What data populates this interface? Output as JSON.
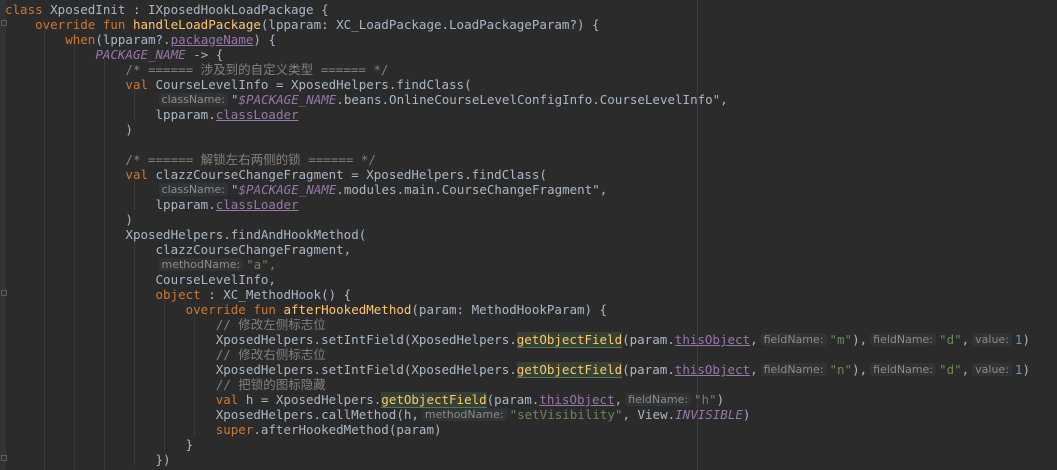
{
  "editor": {
    "lines": [
      [
        {
          "t": "class ",
          "c": "kw"
        },
        {
          "t": "XposedInit"
        },
        {
          "t": " : IXposedHookLoadPackage {"
        }
      ],
      [
        {
          "t": "    "
        },
        {
          "t": "override fun ",
          "c": "kw"
        },
        {
          "t": "handleLoadPackage",
          "c": "fn"
        },
        {
          "t": "(lpparam: XC_LoadPackage.LoadPackageParam?) {"
        }
      ],
      [
        {
          "t": "        "
        },
        {
          "t": "when",
          "c": "kw"
        },
        {
          "t": "(lpparam?."
        },
        {
          "t": "packageName",
          "c": "prop ul"
        },
        {
          "t": ") {"
        }
      ],
      [
        {
          "t": "            "
        },
        {
          "t": "PACKAGE_NAME",
          "c": "prop ital"
        },
        {
          "t": " -> {"
        }
      ],
      [
        {
          "t": "                "
        },
        {
          "t": "/* ====== 涉及到的自定义类型 ====== */",
          "c": "cmt"
        }
      ],
      [
        {
          "t": "                "
        },
        {
          "t": "val ",
          "c": "kw"
        },
        {
          "t": "CourseLevelInfo = XposedHelpers.findClass("
        }
      ],
      [
        {
          "t": "                    "
        },
        {
          "t": "className:",
          "c": "hint"
        },
        {
          "t": "\""
        },
        {
          "t": "$PACKAGE_NAME",
          "c": "prop ital"
        },
        {
          "t": ".beans.OnlineCourseLevelConfigInfo.CourseLevelInfo\","
        }
      ],
      [
        {
          "t": "                    "
        },
        {
          "t": "lpparam."
        },
        {
          "t": "classLoader",
          "c": "prop ul"
        }
      ],
      [
        {
          "t": "                )"
        }
      ],
      [
        {
          "t": ""
        }
      ],
      [
        {
          "t": "                "
        },
        {
          "t": "/* ====== 解锁左右两侧的锁 ====== */",
          "c": "cmt"
        }
      ],
      [
        {
          "t": "                "
        },
        {
          "t": "val ",
          "c": "kw"
        },
        {
          "t": "clazzCourseChangeFragment = XposedHelpers.findClass("
        }
      ],
      [
        {
          "t": "                    "
        },
        {
          "t": "className:",
          "c": "hint"
        },
        {
          "t": "\""
        },
        {
          "t": "$PACKAGE_NAME",
          "c": "prop ital"
        },
        {
          "t": ".modules.main.CourseChangeFragment\","
        }
      ],
      [
        {
          "t": "                    "
        },
        {
          "t": "lpparam."
        },
        {
          "t": "classLoader",
          "c": "prop ul"
        }
      ],
      [
        {
          "t": "                )"
        }
      ],
      [
        {
          "t": "                "
        },
        {
          "t": "XposedHelpers.findAndHookMethod("
        }
      ],
      [
        {
          "t": "                    "
        },
        {
          "t": "clazzCourseChangeFragment,"
        }
      ],
      [
        {
          "t": "                    "
        },
        {
          "t": "methodName:",
          "c": "hint"
        },
        {
          "t": "\"a\",",
          "c": "str"
        }
      ],
      [
        {
          "t": "                    "
        },
        {
          "t": "CourseLevelInfo,"
        }
      ],
      [
        {
          "t": "                    "
        },
        {
          "t": "object",
          "c": "kw"
        },
        {
          "t": " : XC_MethodHook() {"
        }
      ],
      [
        {
          "t": "                        "
        },
        {
          "t": "override fun ",
          "c": "kw"
        },
        {
          "t": "afterHookedMethod",
          "c": "fn"
        },
        {
          "t": "(param: MethodHookParam) {"
        }
      ],
      [
        {
          "t": "                            "
        },
        {
          "t": "// 修改左侧标志位",
          "c": "cmt"
        }
      ],
      [
        {
          "t": "                            "
        },
        {
          "t": "XposedHelpers.setIntField(XposedHelpers."
        },
        {
          "t": "getObjectField",
          "c": "fn hl"
        },
        {
          "t": "(param."
        },
        {
          "t": "thisObject",
          "c": "prop ul"
        },
        {
          "t": ","
        },
        {
          "t": "fieldName:",
          "c": "hint"
        },
        {
          "t": "\"m\"",
          "c": "str"
        },
        {
          "t": "),"
        },
        {
          "t": "fieldName:",
          "c": "hint"
        },
        {
          "t": "\"d\"",
          "c": "str"
        },
        {
          "t": ","
        },
        {
          "t": "value:",
          "c": "hint"
        },
        {
          "t": "1",
          "c": "num"
        },
        {
          "t": ")"
        }
      ],
      [
        {
          "t": "                            "
        },
        {
          "t": "// 修改右侧标志位",
          "c": "cmt"
        }
      ],
      [
        {
          "t": "                            "
        },
        {
          "t": "XposedHelpers.setIntField(XposedHelpers."
        },
        {
          "t": "getObjectField",
          "c": "fn hl"
        },
        {
          "t": "(param."
        },
        {
          "t": "thisObject",
          "c": "prop ul"
        },
        {
          "t": ","
        },
        {
          "t": "fieldName:",
          "c": "hint"
        },
        {
          "t": "\"n\"",
          "c": "str"
        },
        {
          "t": "),"
        },
        {
          "t": "fieldName:",
          "c": "hint"
        },
        {
          "t": "\"d\"",
          "c": "str"
        },
        {
          "t": ","
        },
        {
          "t": "value:",
          "c": "hint"
        },
        {
          "t": "1",
          "c": "num"
        },
        {
          "t": ")"
        }
      ],
      [
        {
          "t": "                            "
        },
        {
          "t": "// 把锁的图标隐藏",
          "c": "cmt"
        }
      ],
      [
        {
          "t": "                            "
        },
        {
          "t": "val ",
          "c": "kw"
        },
        {
          "t": "h = XposedHelpers."
        },
        {
          "t": "getObjectField",
          "c": "fn hl"
        },
        {
          "t": "(param."
        },
        {
          "t": "thisObject",
          "c": "prop ul"
        },
        {
          "t": ","
        },
        {
          "t": "fieldName:",
          "c": "hint"
        },
        {
          "t": "\"h\"",
          "c": "str"
        },
        {
          "t": ")"
        }
      ],
      [
        {
          "t": "                            "
        },
        {
          "t": "XposedHelpers.callMethod(h,"
        },
        {
          "t": "methodName:",
          "c": "hint"
        },
        {
          "t": "\"setVisibility\"",
          "c": "str"
        },
        {
          "t": ", View."
        },
        {
          "t": "INVISIBLE",
          "c": "prop ital"
        },
        {
          "t": ")"
        }
      ],
      [
        {
          "t": "                            "
        },
        {
          "t": "super",
          "c": "kw"
        },
        {
          "t": ".afterHookedMethod(param)"
        }
      ],
      [
        {
          "t": "                        "
        },
        {
          "t": "}"
        }
      ],
      [
        {
          "t": "                    "
        },
        {
          "t": "})"
        }
      ]
    ]
  }
}
